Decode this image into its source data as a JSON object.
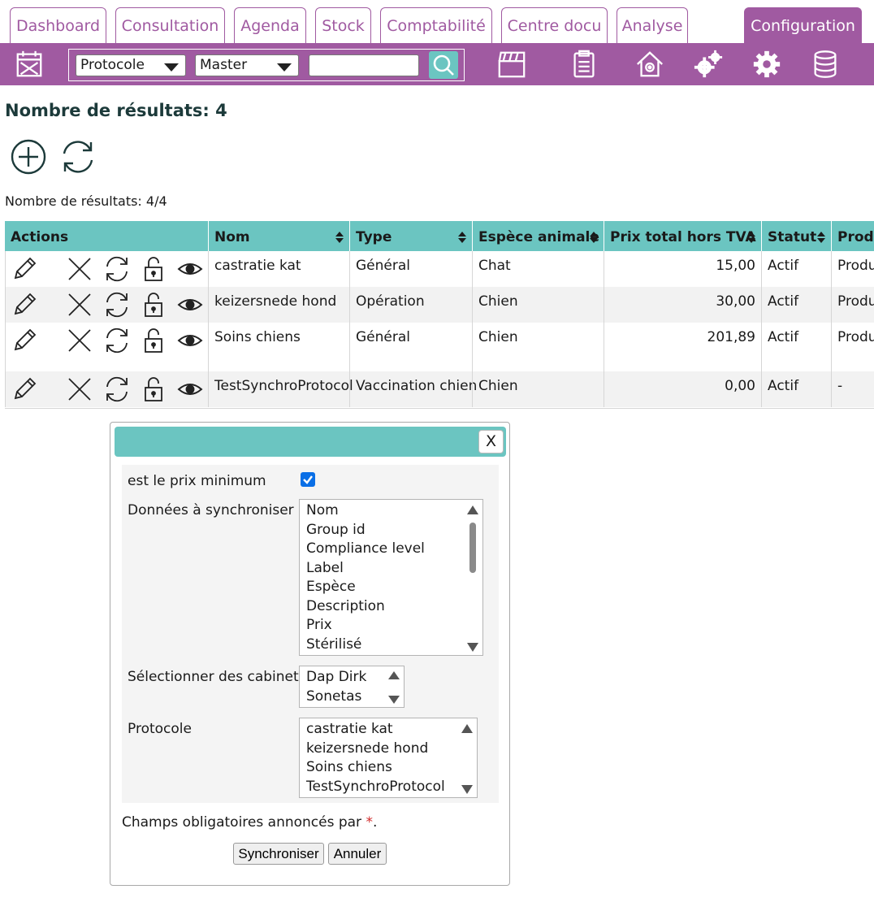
{
  "tabs": [
    {
      "label": "Dashboard",
      "active": false
    },
    {
      "label": "Consultation",
      "active": false
    },
    {
      "label": "Agenda",
      "active": false
    },
    {
      "label": "Stock",
      "active": false
    },
    {
      "label": "Comptabilité",
      "active": false
    },
    {
      "label": "Centre docu",
      "active": false
    },
    {
      "label": "Analyse",
      "active": false
    },
    {
      "label": "Configuration",
      "active": true
    }
  ],
  "toolbar": {
    "select_type": "Protocole",
    "select_scope": "Master",
    "search_value": "",
    "icons": [
      "calendar-icon",
      "clapperboard-icon",
      "clipboard-icon",
      "house-gear-icon",
      "gears-icon",
      "gear-icon",
      "database-icon"
    ]
  },
  "page": {
    "heading": "Nombre de résultats: 4",
    "count": "Nombre de résultats: 4/4"
  },
  "table": {
    "columns": [
      "Actions",
      "Nom",
      "Type",
      "Espèce animale",
      "Prix total hors TVA",
      "Statut",
      "Produ"
    ],
    "rows": [
      {
        "nom": "castratie kat",
        "type": "Général",
        "espece": "Chat",
        "prix": "15,00",
        "statut": "Actif",
        "produit": "Produ"
      },
      {
        "nom": "keizersnede hond",
        "type": "Opération",
        "espece": "Chien",
        "prix": "30,00",
        "statut": "Actif",
        "produit": "Produ"
      },
      {
        "nom": "Soins chiens",
        "type": "Général",
        "espece": "Chien",
        "prix": "201,89",
        "statut": "Actif",
        "produit": "Produ"
      },
      {
        "nom": "TestSynchroProtocol",
        "type": "Vaccination chien",
        "espece": "Chien",
        "prix": "0,00",
        "statut": "Actif",
        "produit": "-"
      }
    ]
  },
  "dialog": {
    "close_label": "X",
    "min_price_label": "est le prix minimum",
    "min_price_checked": true,
    "sync_data_label": "Données à synchroniser",
    "sync_data_options": [
      "Nom",
      "Group id",
      "Compliance level",
      "Label",
      "Espèce",
      "Description",
      "Prix",
      "Stérilisé"
    ],
    "cabinets_label": "Sélectionner des cabinets",
    "cabinets_options": [
      "Dap Dirk",
      "Sonetas"
    ],
    "protocol_label": "Protocole",
    "protocol_options": [
      "castratie kat",
      "keizersnede hond",
      "Soins chiens",
      "TestSynchroProtocol"
    ],
    "required_note": "Champs obligatoires annoncés par",
    "required_star": "*",
    "required_period": ".",
    "sync_button": "Synchroniser",
    "cancel_button": "Annuler"
  },
  "colors": {
    "brand_purple": "#a05aa1",
    "header_teal": "#6bc5c1",
    "checkbox_blue": "#0a6fe6"
  }
}
